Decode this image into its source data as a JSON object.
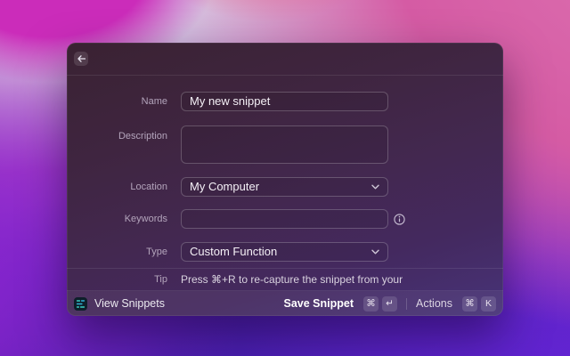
{
  "form": {
    "fields": [
      {
        "id": "name",
        "label": "Name",
        "value": "My new snippet"
      },
      {
        "id": "description",
        "label": "Description",
        "value": ""
      },
      {
        "id": "location",
        "label": "Location",
        "value": "My Computer"
      },
      {
        "id": "keywords",
        "label": "Keywords",
        "value": ""
      },
      {
        "id": "type",
        "label": "Type",
        "value": "Custom Function"
      }
    ],
    "tip": {
      "label": "Tip",
      "text": "Press ⌘+R to re-capture the snippet from your"
    }
  },
  "action_bar": {
    "view_snippets_label": "View Snippets",
    "save": {
      "label": "Save Snippet",
      "keys": [
        "⌘",
        "↵"
      ]
    },
    "actions": {
      "label": "Actions",
      "keys": [
        "⌘",
        "K"
      ]
    }
  },
  "icons": {
    "back": "←",
    "chevron_down": "⌄",
    "info": "ⓘ",
    "snippets": "snippet-lines"
  },
  "colors": {
    "accent_cyan": "#39d1c4",
    "window_top": "#3a2232",
    "window_bottom": "#473379",
    "wallpaper_pink": "#d55ba4",
    "wallpaper_purple": "#6f28c9",
    "wallpaper_magenta": "#cb2cba"
  }
}
